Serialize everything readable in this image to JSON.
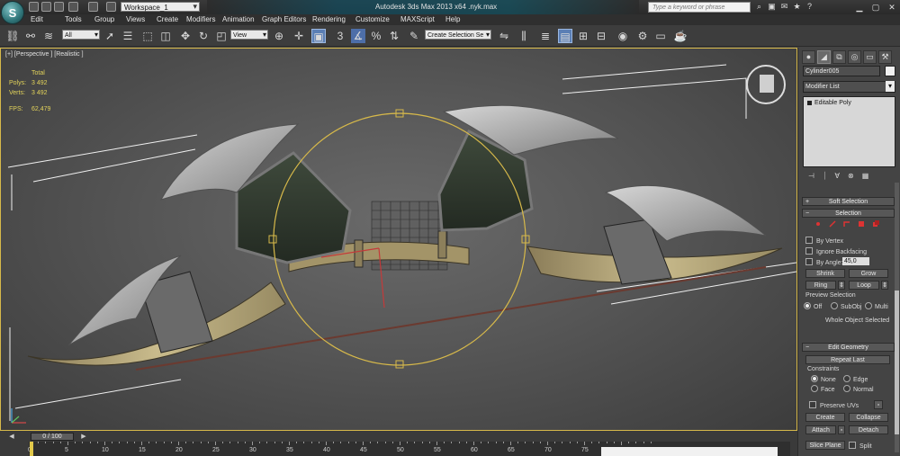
{
  "titlebar": {
    "workspace": "Workspace_1",
    "title": "Autodesk 3ds Max  2013 x64     .nyk.max",
    "search_placeholder": "Type a keyword or phrase",
    "logo": "S"
  },
  "menu": [
    "Edit",
    "Tools",
    "Group",
    "Views",
    "Create",
    "Modifiers",
    "Animation",
    "Graph Editors",
    "Rendering",
    "Customize",
    "MAXScript",
    "Help"
  ],
  "toolbar": {
    "filter": "All",
    "ref_coord": "View",
    "selection_set": "Create Selection Se",
    "snap_label": "3"
  },
  "viewport": {
    "label": "[+] [Perspective ] [Realistic ]",
    "stats": {
      "header": "Total",
      "polys_label": "Polys:",
      "polys": "3 492",
      "verts_label": "Verts:",
      "verts": "3 492",
      "fps_label": "FPS:",
      "fps": "62,479"
    },
    "accent_color": "#d7b94a"
  },
  "panel": {
    "object_name": "Cylinder005",
    "modifier_list": "Modifier List",
    "stack_item": "Editable Poly",
    "soft_selection": "Soft Selection",
    "selection": "Selection",
    "by_vertex": "By Vertex",
    "ignore_backfacing": "Ignore Backfacing",
    "by_angle": "By Angle:",
    "angle_value": "45,0",
    "shrink": "Shrink",
    "grow": "Grow",
    "ring": "Ring",
    "loop": "Loop",
    "preview_selection": "Preview Selection",
    "preview_off": "Off",
    "preview_subobj": "SubObj",
    "preview_multi": "Multi",
    "whole_object": "Whole Object Selected",
    "edit_geometry": "Edit Geometry",
    "repeat_last": "Repeat Last",
    "constraints": "Constraints",
    "c_none": "None",
    "c_edge": "Edge",
    "c_face": "Face",
    "c_normal": "Normal",
    "preserve_uvs": "Preserve UVs",
    "create": "Create",
    "collapse": "Collapse",
    "attach": "Attach",
    "detach": "Detach",
    "slice_plane": "Slice Plane",
    "split": "Split"
  },
  "timeline": {
    "slider": "0 / 100",
    "ticks": [
      "0",
      "5",
      "10",
      "15",
      "20",
      "25",
      "30",
      "35",
      "40",
      "45",
      "50",
      "55",
      "60",
      "65",
      "70",
      "75",
      "80"
    ]
  }
}
